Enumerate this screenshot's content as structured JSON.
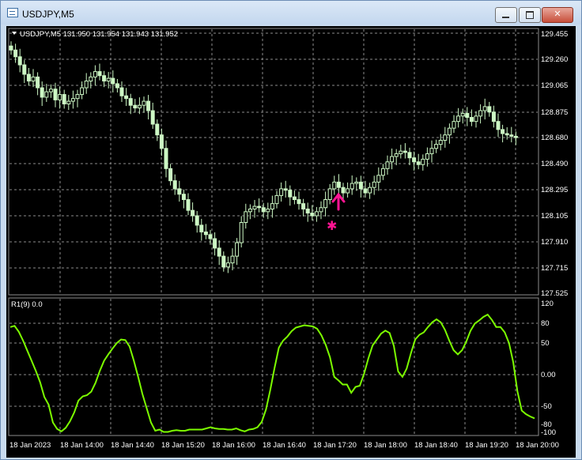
{
  "window": {
    "title": "USDJPY,M5",
    "minimize_glyph": "",
    "maximize_glyph": "",
    "close_glyph": "✕"
  },
  "main_chart": {
    "header": "USDJPY,M5  131.950 131.954 131.943 131.952",
    "price_labels": [
      "129.455",
      "129.260",
      "129.065",
      "128.875",
      "128.680",
      "128.490",
      "128.295",
      "128.105",
      "127.910",
      "127.715",
      "127.525"
    ],
    "colors": {
      "background": "#000000",
      "grid": "#8c8c8c",
      "candle": "#ccf7c4",
      "marker": "#ff1493"
    }
  },
  "indicator": {
    "header": "R1(9) 0.0",
    "labels": [
      "120",
      "80",
      "50",
      "0.00",
      "-50",
      "-80",
      "-100"
    ],
    "line_color": "#7cfc00"
  },
  "time_axis": {
    "labels": [
      "18 Jan 2023",
      "18 Jan 14:00",
      "18 Jan 14:40",
      "18 Jan 15:20",
      "18 Jan 16:00",
      "18 Jan 16:40",
      "18 Jan 17:20",
      "18 Jan 18:00",
      "18 Jan 18:40",
      "18 Jan 19:20",
      "18 Jan 20:00"
    ]
  },
  "chart_data": {
    "type": "candlestick",
    "price_range": [
      127.525,
      129.455
    ],
    "indicator_range": [
      -100,
      120
    ],
    "candles_close": [
      129.33,
      129.28,
      129.22,
      129.15,
      129.1,
      129.13,
      129.05,
      128.98,
      129.02,
      129.04,
      128.96,
      129.0,
      128.93,
      128.95,
      128.97,
      129.0,
      129.05,
      129.1,
      129.13,
      129.17,
      129.14,
      129.1,
      129.12,
      129.08,
      129.05,
      128.99,
      128.97,
      128.92,
      128.9,
      128.92,
      128.95,
      128.88,
      128.78,
      128.7,
      128.6,
      128.45,
      128.36,
      128.3,
      128.26,
      128.22,
      128.14,
      128.1,
      128.03,
      127.98,
      127.96,
      127.93,
      127.86,
      127.8,
      127.72,
      127.75,
      127.8,
      127.9,
      128.05,
      128.13,
      128.15,
      128.17,
      128.16,
      128.13,
      128.15,
      128.19,
      128.25,
      128.3,
      128.29,
      128.24,
      128.22,
      128.19,
      128.15,
      128.12,
      128.1,
      128.13,
      128.16,
      128.22,
      128.3,
      128.35,
      128.31,
      128.27,
      128.3,
      128.34,
      128.35,
      128.3,
      128.27,
      128.31,
      128.35,
      128.4,
      128.45,
      128.5,
      128.54,
      128.56,
      128.58,
      128.57,
      128.53,
      128.5,
      128.48,
      128.52,
      128.56,
      128.6,
      128.63,
      128.66,
      128.7,
      128.75,
      128.8,
      128.84,
      128.86,
      128.83,
      128.8,
      128.84,
      128.88,
      128.91,
      128.87,
      128.8,
      128.74,
      128.71,
      128.7,
      128.69,
      128.68
    ],
    "indicator_values": [
      79,
      81,
      71,
      56,
      39,
      22,
      5,
      -14,
      -39,
      -52,
      -82,
      -93,
      -97,
      -91,
      -80,
      -65,
      -45,
      -38,
      -36,
      -30,
      -15,
      5,
      22,
      33,
      43,
      52,
      58,
      57,
      46,
      22,
      -5,
      -34,
      -58,
      -82,
      -96,
      -94,
      -98,
      -98,
      -96,
      -95,
      -96,
      -96,
      -94,
      -94,
      -94,
      -94,
      -92,
      -90,
      -92,
      -93,
      -93,
      -94,
      -94,
      -92,
      -95,
      -97,
      -94,
      -93,
      -90,
      -81,
      -60,
      -27,
      10,
      44,
      56,
      63,
      72,
      78,
      80,
      82,
      81,
      80,
      76,
      65,
      49,
      28,
      -5,
      -11,
      -18,
      -18,
      -32,
      -22,
      -20,
      0,
      26,
      48,
      58,
      68,
      73,
      69,
      47,
      4,
      -5,
      9,
      35,
      58,
      66,
      70,
      79,
      87,
      92,
      87,
      74,
      56,
      40,
      33,
      40,
      55,
      73,
      85,
      90,
      96,
      100,
      91,
      79,
      79,
      70,
      52,
      20,
      -30,
      -62,
      -68,
      -72,
      -75
    ]
  }
}
